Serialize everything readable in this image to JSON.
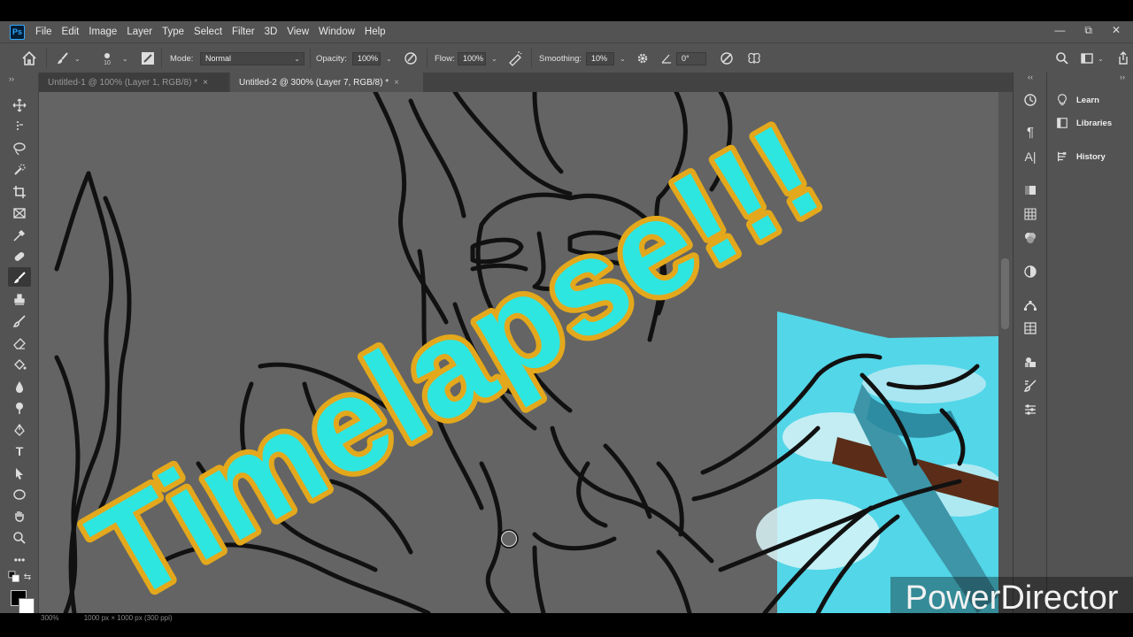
{
  "app": {
    "logo_text": "Ps"
  },
  "menu": [
    "File",
    "Edit",
    "Image",
    "Layer",
    "Type",
    "Select",
    "Filter",
    "3D",
    "View",
    "Window",
    "Help"
  ],
  "window_controls": {
    "minimize": "—",
    "restore": "⧉",
    "close": "✕"
  },
  "options": {
    "brush_size": "10",
    "mode_label": "Mode:",
    "mode_value": "Normal",
    "opacity_label": "Opacity:",
    "opacity_value": "100%",
    "flow_label": "Flow:",
    "flow_value": "100%",
    "smoothing_label": "Smoothing:",
    "smoothing_value": "10%",
    "angle_value": "0°"
  },
  "tabs": [
    {
      "label": "Untitled-1 @ 100% (Layer 1, RGB/8) *",
      "active": false
    },
    {
      "label": "Untitled-2 @ 300% (Layer 7, RGB/8) *",
      "active": true
    }
  ],
  "panels": [
    {
      "label": "Learn",
      "icon": "lightbulb-icon"
    },
    {
      "label": "Libraries",
      "icon": "libraries-icon"
    },
    {
      "label": "History",
      "icon": "history-icon"
    }
  ],
  "overlay": {
    "title": "Timelapse!!!",
    "watermark": "PowerDirector"
  },
  "status": {
    "zoom": "300%",
    "doc_size": "1000 px × 1000 px (300 ppi)"
  },
  "colors": {
    "title_fill": "#2ee6e0",
    "title_outline": "#e3a81c",
    "panel_bg": "#535353",
    "canvas_bg": "#646464"
  }
}
